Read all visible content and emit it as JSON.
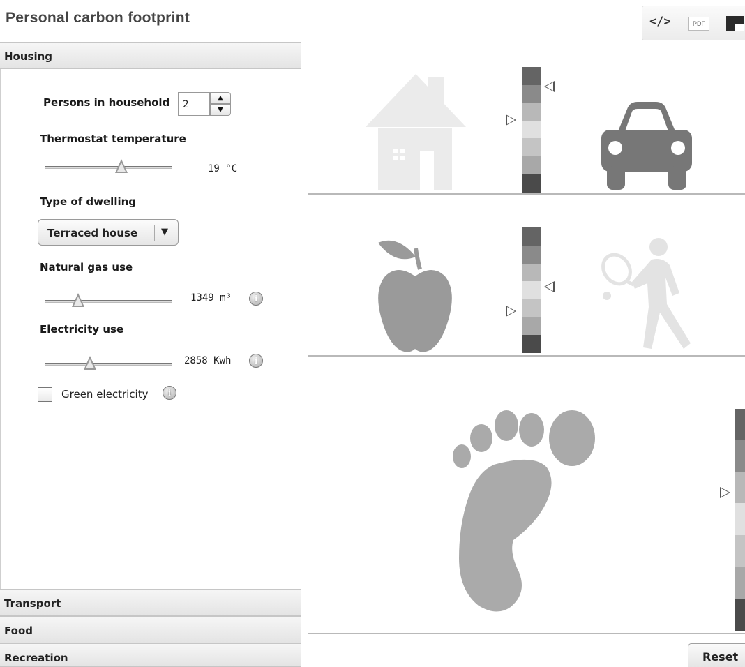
{
  "app": {
    "title": "Personal carbon footprint"
  },
  "toolbar": {
    "code_label": "</>",
    "pdf_label": "PDF"
  },
  "sections": {
    "housing": "Housing",
    "transport": "Transport",
    "food": "Food",
    "recreation": "Recreation"
  },
  "housing": {
    "persons_label": "Persons in household",
    "persons_value": "2",
    "thermostat_label": "Thermostat temperature",
    "thermostat_value": "19 °C",
    "thermostat_fraction": 0.6,
    "dwelling_label": "Type of dwelling",
    "dwelling_selected": "Terraced house",
    "gas_label": "Natural gas use",
    "gas_value": "1349 m³",
    "gas_fraction": 0.26,
    "electricity_label": "Electricity use",
    "electricity_value": "2858 Kwh",
    "electricity_fraction": 0.35,
    "green_label": "Green electricity",
    "green_checked": false
  },
  "scale_colors": [
    "#646464",
    "#8a8a8a",
    "#b8b8b8",
    "#e0e0e0",
    "#c4c4c4",
    "#a8a8a8",
    "#4a4a4a"
  ],
  "icons": {
    "house": {
      "name": "house-icon",
      "color": "#ebebeb"
    },
    "car": {
      "name": "car-icon",
      "color": "#777777"
    },
    "apple": {
      "name": "apple-icon",
      "color": "#9a9a9a"
    },
    "tennis": {
      "name": "tennis-player-icon",
      "color": "#e3e3e3"
    },
    "foot": {
      "name": "footprint-icon",
      "color": "#aaaaaa"
    }
  },
  "reset_label": "Reset"
}
